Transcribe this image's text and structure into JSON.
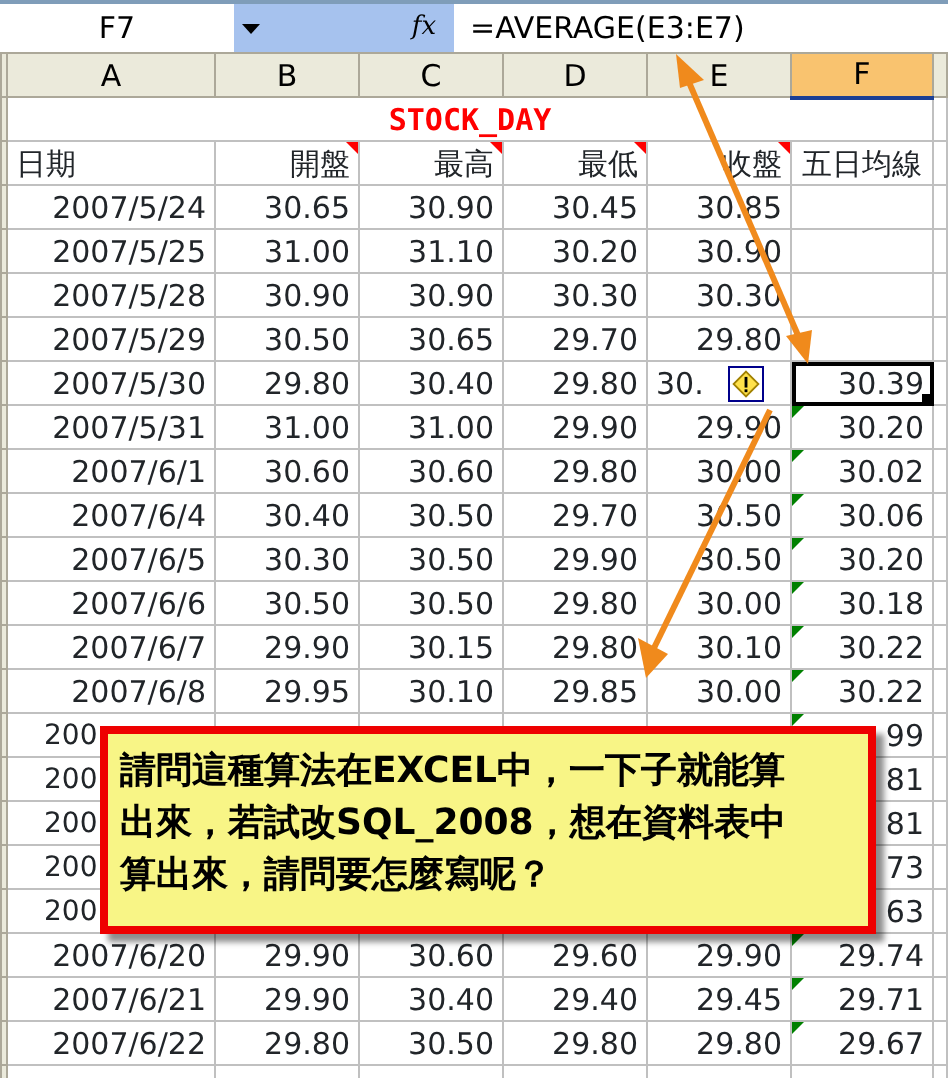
{
  "name_box": {
    "value": "F7"
  },
  "formula_bar": {
    "function_button": "fx",
    "formula": "=AVERAGE(E3:E7)"
  },
  "columns": [
    {
      "label": "A",
      "selected": false
    },
    {
      "label": "B",
      "selected": false
    },
    {
      "label": "C",
      "selected": false
    },
    {
      "label": "D",
      "selected": false
    },
    {
      "label": "E",
      "selected": false
    },
    {
      "label": "F",
      "selected": true
    }
  ],
  "title": "STOCK_DAY",
  "header": [
    {
      "text": "日期",
      "comment": false
    },
    {
      "text": "開盤",
      "comment": true
    },
    {
      "text": "最高",
      "comment": true
    },
    {
      "text": "最低",
      "comment": true
    },
    {
      "text": "收盤",
      "comment": true
    },
    {
      "text": "五日均線",
      "comment": false
    }
  ],
  "rows": [
    {
      "covered": false,
      "cells": [
        "2007/5/24",
        "30.65",
        "30.90",
        "30.45",
        "30.85"
      ],
      "smart_tag": false,
      "f": {
        "error_flag": false,
        "selected": false
      }
    },
    {
      "covered": false,
      "cells": [
        "2007/5/25",
        "31.00",
        "31.10",
        "30.20",
        "30.90"
      ],
      "smart_tag": false,
      "f": {
        "error_flag": false,
        "selected": false
      }
    },
    {
      "covered": false,
      "cells": [
        "2007/5/28",
        "30.90",
        "30.90",
        "30.30",
        "30.30"
      ],
      "smart_tag": false,
      "f": {
        "error_flag": false,
        "selected": false
      }
    },
    {
      "covered": false,
      "cells": [
        "2007/5/29",
        "30.50",
        "30.65",
        "29.70",
        "29.80"
      ],
      "smart_tag": false,
      "f": {
        "error_flag": false,
        "selected": false
      }
    },
    {
      "covered": false,
      "cells": [
        "2007/5/30",
        "29.80",
        "30.40",
        "29.80",
        "30."
      ],
      "smart_tag": true,
      "f": {
        "text": "30.39",
        "error_flag": false,
        "selected": true
      }
    },
    {
      "covered": false,
      "cells": [
        "2007/5/31",
        "31.00",
        "31.00",
        "29.90",
        "29.90"
      ],
      "smart_tag": false,
      "f": {
        "text": "30.20",
        "error_flag": true,
        "selected": false
      }
    },
    {
      "covered": false,
      "cells": [
        "2007/6/1",
        "30.60",
        "30.60",
        "29.80",
        "30.00"
      ],
      "smart_tag": false,
      "f": {
        "text": "30.02",
        "error_flag": true,
        "selected": false
      }
    },
    {
      "covered": false,
      "cells": [
        "2007/6/4",
        "30.40",
        "30.50",
        "29.70",
        "30.50"
      ],
      "smart_tag": false,
      "f": {
        "text": "30.06",
        "error_flag": true,
        "selected": false
      }
    },
    {
      "covered": false,
      "cells": [
        "2007/6/5",
        "30.30",
        "30.50",
        "29.90",
        "30.50"
      ],
      "smart_tag": false,
      "f": {
        "text": "30.20",
        "error_flag": true,
        "selected": false
      }
    },
    {
      "covered": false,
      "cells": [
        "2007/6/6",
        "30.50",
        "30.50",
        "29.80",
        "30.00"
      ],
      "smart_tag": false,
      "f": {
        "text": "30.18",
        "error_flag": true,
        "selected": false
      }
    },
    {
      "covered": false,
      "cells": [
        "2007/6/7",
        "29.90",
        "30.15",
        "29.80",
        "30.10"
      ],
      "smart_tag": false,
      "f": {
        "text": "30.22",
        "error_flag": true,
        "selected": false
      }
    },
    {
      "covered": false,
      "cells": [
        "2007/6/8",
        "29.95",
        "30.10",
        "29.85",
        "30.00"
      ],
      "smart_tag": false,
      "f": {
        "text": "30.22",
        "error_flag": true,
        "selected": false
      }
    },
    {
      "covered": true,
      "cells": [
        "200"
      ],
      "smart_tag": false,
      "f": {
        "text": "99",
        "error_flag": true,
        "selected": false
      }
    },
    {
      "covered": true,
      "cells": [
        "200"
      ],
      "smart_tag": false,
      "f": {
        "text": "81",
        "selected": false
      }
    },
    {
      "covered": true,
      "cells": [
        "200"
      ],
      "smart_tag": false,
      "f": {
        "text": "81",
        "selected": false
      }
    },
    {
      "covered": true,
      "cells": [
        "200"
      ],
      "smart_tag": false,
      "f": {
        "text": "73",
        "selected": false
      }
    },
    {
      "covered": true,
      "cells": [
        "200"
      ],
      "smart_tag": false,
      "f": {
        "text": "63",
        "selected": false
      }
    },
    {
      "covered": false,
      "cells": [
        "2007/6/20",
        "29.90",
        "30.60",
        "29.60",
        "29.90"
      ],
      "smart_tag": false,
      "f": {
        "text": "29.74",
        "error_flag": true,
        "selected": false
      }
    },
    {
      "covered": false,
      "cells": [
        "2007/6/21",
        "29.90",
        "30.40",
        "29.40",
        "29.45"
      ],
      "smart_tag": false,
      "f": {
        "text": "29.71",
        "error_flag": true,
        "selected": false
      }
    },
    {
      "covered": false,
      "cells": [
        "2007/6/22",
        "29.80",
        "30.50",
        "29.80",
        "29.80"
      ],
      "smart_tag": false,
      "f": {
        "text": "29.67",
        "error_flag": true,
        "selected": false
      }
    }
  ],
  "callout": {
    "text": "請問這種算法在EXCEL中，一下子就能算出來，若試改SQL_2008，想在資料表中算出來，請問要怎麼寫呢？"
  }
}
